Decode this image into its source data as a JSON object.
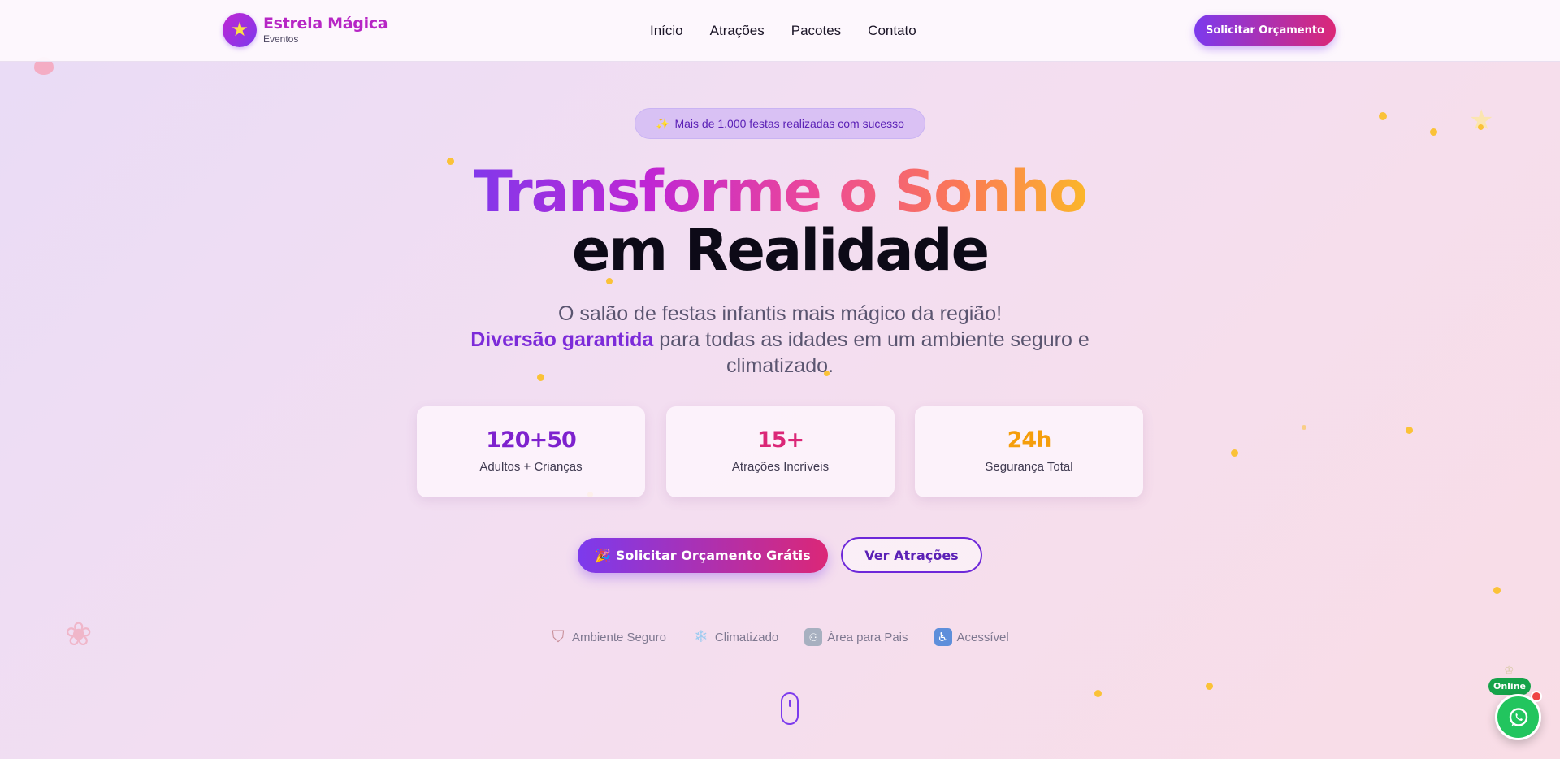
{
  "header": {
    "brand_name": "Estrela Mágica",
    "brand_sub": "Eventos",
    "logo_icon": "star-icon",
    "nav": [
      "Início",
      "Atrações",
      "Pacotes",
      "Contato"
    ],
    "cta_label": "Solicitar Orçamento"
  },
  "hero": {
    "badge_icon": "sparkles-icon",
    "badge_emoji": "✨",
    "badge_text": "Mais de 1.000 festas realizadas com sucesso",
    "title_line1": "Transforme o Sonho",
    "title_line2": "em Realidade",
    "subtitle_line1": "O salão de festas infantis mais mágico da região!",
    "subtitle_highlight": "Diversão garantida",
    "subtitle_rest": " para todas as idades em um ambiente seguro e climatizado."
  },
  "stats": [
    {
      "value": "120+50",
      "label": "Adultos + Crianças",
      "color": "#7e22ce"
    },
    {
      "value": "15+",
      "label": "Atrações Incríveis",
      "color": "#db2777"
    },
    {
      "value": "24h",
      "label": "Segurança Total",
      "color": "#f59e0b"
    }
  ],
  "ctas": {
    "primary_emoji": "🎉",
    "primary_label": "Solicitar Orçamento Grátis",
    "secondary_label": "Ver Atrações"
  },
  "features": [
    {
      "icon": "shield-icon",
      "label": "Ambiente Seguro"
    },
    {
      "icon": "snowflake-icon",
      "label": "Climatizado"
    },
    {
      "icon": "family-icon",
      "label": "Área para Pais"
    },
    {
      "icon": "wheelchair-icon",
      "label": "Acessível"
    }
  ],
  "whatsapp": {
    "status": "Online",
    "icon": "whatsapp-icon"
  },
  "colors": {
    "primary": "#7c3aed",
    "accent": "#db2777",
    "whatsapp": "#22c55e"
  }
}
